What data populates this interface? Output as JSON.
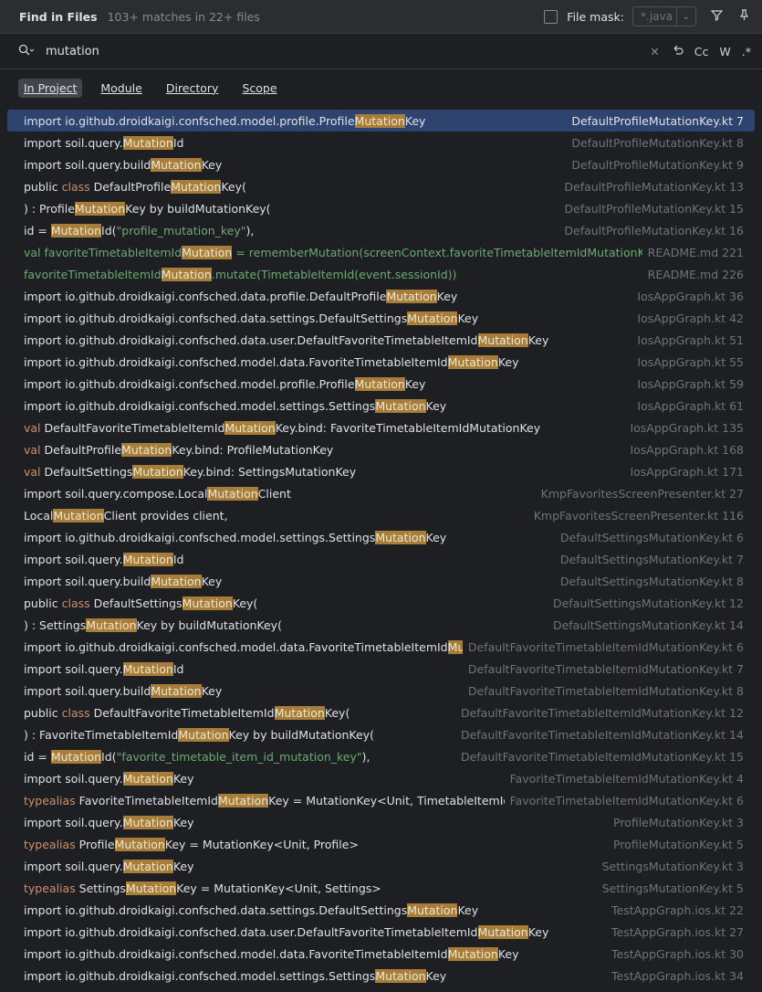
{
  "header": {
    "title": "Find in Files",
    "matches": "103+ matches in 22+ files",
    "file_mask_label": "File mask:",
    "file_mask_value": "*.java"
  },
  "search": {
    "query": "mutation",
    "toggle_case": "Cc",
    "toggle_words": "W",
    "toggle_regex": ".*"
  },
  "scopes": [
    "In Project",
    "Module",
    "Directory",
    "Scope"
  ],
  "results": [
    {
      "code": [
        [
          "t",
          "import io.github.droidkaigi.confsched.model.profile.Profile"
        ],
        [
          "h",
          "Mutation"
        ],
        [
          "t",
          "Key"
        ]
      ],
      "file": "DefaultProfileMutationKey.kt 7",
      "selected": true
    },
    {
      "code": [
        [
          "t",
          "import soil.query."
        ],
        [
          "h",
          "Mutation"
        ],
        [
          "t",
          "Id"
        ]
      ],
      "file": "DefaultProfileMutationKey.kt 8"
    },
    {
      "code": [
        [
          "t",
          "import soil.query.build"
        ],
        [
          "h",
          "Mutation"
        ],
        [
          "t",
          "Key"
        ]
      ],
      "file": "DefaultProfileMutationKey.kt 9"
    },
    {
      "code": [
        [
          "t",
          "public "
        ],
        [
          "k",
          "class"
        ],
        [
          "t",
          " DefaultProfile"
        ],
        [
          "h",
          "Mutation"
        ],
        [
          "t",
          "Key("
        ]
      ],
      "file": "DefaultProfileMutationKey.kt 13"
    },
    {
      "code": [
        [
          "t",
          ") : Profile"
        ],
        [
          "h",
          "Mutation"
        ],
        [
          "t",
          "Key by buildMutationKey("
        ]
      ],
      "file": "DefaultProfileMutationKey.kt 15"
    },
    {
      "code": [
        [
          "t",
          "id = "
        ],
        [
          "h",
          "Mutation"
        ],
        [
          "t",
          "Id("
        ],
        [
          "s",
          "\"profile_mutation_key\""
        ],
        [
          "t",
          "),"
        ]
      ],
      "file": "DefaultProfileMutationKey.kt 16"
    },
    {
      "code": [
        [
          "g",
          "  val favoriteTimetableItemId"
        ],
        [
          "h",
          "Mutation"
        ],
        [
          "g",
          " = rememberMutation(screenContext.favoriteTimetableItemIdMutationKey)"
        ]
      ],
      "file": "README.md 221"
    },
    {
      "code": [
        [
          "g",
          "            favoriteTimetableItemId"
        ],
        [
          "h",
          "Mutation"
        ],
        [
          "g",
          ".mutate(TimetableItemId(event.sessionId))"
        ]
      ],
      "file": "README.md 226"
    },
    {
      "code": [
        [
          "t",
          "import io.github.droidkaigi.confsched.data.profile.DefaultProfile"
        ],
        [
          "h",
          "Mutation"
        ],
        [
          "t",
          "Key"
        ]
      ],
      "file": "IosAppGraph.kt 36"
    },
    {
      "code": [
        [
          "t",
          "import io.github.droidkaigi.confsched.data.settings.DefaultSettings"
        ],
        [
          "h",
          "Mutation"
        ],
        [
          "t",
          "Key"
        ]
      ],
      "file": "IosAppGraph.kt 42"
    },
    {
      "code": [
        [
          "t",
          "import io.github.droidkaigi.confsched.data.user.DefaultFavoriteTimetableItemId"
        ],
        [
          "h",
          "Mutation"
        ],
        [
          "t",
          "Key"
        ]
      ],
      "file": "IosAppGraph.kt 51"
    },
    {
      "code": [
        [
          "t",
          "import io.github.droidkaigi.confsched.model.data.FavoriteTimetableItemId"
        ],
        [
          "h",
          "Mutation"
        ],
        [
          "t",
          "Key"
        ]
      ],
      "file": "IosAppGraph.kt 55"
    },
    {
      "code": [
        [
          "t",
          "import io.github.droidkaigi.confsched.model.profile.Profile"
        ],
        [
          "h",
          "Mutation"
        ],
        [
          "t",
          "Key"
        ]
      ],
      "file": "IosAppGraph.kt 59"
    },
    {
      "code": [
        [
          "t",
          "import io.github.droidkaigi.confsched.model.settings.Settings"
        ],
        [
          "h",
          "Mutation"
        ],
        [
          "t",
          "Key"
        ]
      ],
      "file": "IosAppGraph.kt 61"
    },
    {
      "code": [
        [
          "k",
          "val"
        ],
        [
          "t",
          " DefaultFavoriteTimetableItemId"
        ],
        [
          "h",
          "Mutation"
        ],
        [
          "t",
          "Key.bind: FavoriteTimetableItemIdMutationKey"
        ]
      ],
      "file": "IosAppGraph.kt 135"
    },
    {
      "code": [
        [
          "k",
          "val"
        ],
        [
          "t",
          " DefaultProfile"
        ],
        [
          "h",
          "Mutation"
        ],
        [
          "t",
          "Key.bind: ProfileMutationKey"
        ]
      ],
      "file": "IosAppGraph.kt 168"
    },
    {
      "code": [
        [
          "k",
          "val"
        ],
        [
          "t",
          " DefaultSettings"
        ],
        [
          "h",
          "Mutation"
        ],
        [
          "t",
          "Key.bind: SettingsMutationKey"
        ]
      ],
      "file": "IosAppGraph.kt 171"
    },
    {
      "code": [
        [
          "t",
          "import soil.query.compose.Local"
        ],
        [
          "h",
          "Mutation"
        ],
        [
          "t",
          "Client"
        ]
      ],
      "file": "KmpFavoritesScreenPresenter.kt 27"
    },
    {
      "code": [
        [
          "t",
          "Local"
        ],
        [
          "h",
          "Mutation"
        ],
        [
          "t",
          "Client provides client,"
        ]
      ],
      "file": "KmpFavoritesScreenPresenter.kt 116"
    },
    {
      "code": [
        [
          "t",
          "import io.github.droidkaigi.confsched.model.settings.Settings"
        ],
        [
          "h",
          "Mutation"
        ],
        [
          "t",
          "Key"
        ]
      ],
      "file": "DefaultSettingsMutationKey.kt 6"
    },
    {
      "code": [
        [
          "t",
          "import soil.query."
        ],
        [
          "h",
          "Mutation"
        ],
        [
          "t",
          "Id"
        ]
      ],
      "file": "DefaultSettingsMutationKey.kt 7"
    },
    {
      "code": [
        [
          "t",
          "import soil.query.build"
        ],
        [
          "h",
          "Mutation"
        ],
        [
          "t",
          "Key"
        ]
      ],
      "file": "DefaultSettingsMutationKey.kt 8"
    },
    {
      "code": [
        [
          "t",
          "public "
        ],
        [
          "k",
          "class"
        ],
        [
          "t",
          " DefaultSettings"
        ],
        [
          "h",
          "Mutation"
        ],
        [
          "t",
          "Key("
        ]
      ],
      "file": "DefaultSettingsMutationKey.kt 12"
    },
    {
      "code": [
        [
          "t",
          ") : Settings"
        ],
        [
          "h",
          "Mutation"
        ],
        [
          "t",
          "Key by buildMutationKey("
        ]
      ],
      "file": "DefaultSettingsMutationKey.kt 14"
    },
    {
      "code": [
        [
          "t",
          "import io.github.droidkaigi.confsched.model.data.FavoriteTimetableItemId"
        ],
        [
          "h",
          "Mutation"
        ],
        [
          "t",
          "Ke"
        ]
      ],
      "file": "DefaultFavoriteTimetableItemIdMutationKey.kt 6"
    },
    {
      "code": [
        [
          "t",
          "import soil.query."
        ],
        [
          "h",
          "Mutation"
        ],
        [
          "t",
          "Id"
        ]
      ],
      "file": "DefaultFavoriteTimetableItemIdMutationKey.kt 7"
    },
    {
      "code": [
        [
          "t",
          "import soil.query.build"
        ],
        [
          "h",
          "Mutation"
        ],
        [
          "t",
          "Key"
        ]
      ],
      "file": "DefaultFavoriteTimetableItemIdMutationKey.kt 8"
    },
    {
      "code": [
        [
          "t",
          "public "
        ],
        [
          "k",
          "class"
        ],
        [
          "t",
          " DefaultFavoriteTimetableItemId"
        ],
        [
          "h",
          "Mutation"
        ],
        [
          "t",
          "Key("
        ]
      ],
      "file": "DefaultFavoriteTimetableItemIdMutationKey.kt 12"
    },
    {
      "code": [
        [
          "t",
          ") : FavoriteTimetableItemId"
        ],
        [
          "h",
          "Mutation"
        ],
        [
          "t",
          "Key by buildMutationKey("
        ]
      ],
      "file": "DefaultFavoriteTimetableItemIdMutationKey.kt 14"
    },
    {
      "code": [
        [
          "t",
          "id = "
        ],
        [
          "h",
          "Mutation"
        ],
        [
          "t",
          "Id("
        ],
        [
          "s",
          "\"favorite_timetable_item_id_mutation_key\""
        ],
        [
          "t",
          "),"
        ]
      ],
      "file": "DefaultFavoriteTimetableItemIdMutationKey.kt 15"
    },
    {
      "code": [
        [
          "t",
          "import soil.query."
        ],
        [
          "h",
          "Mutation"
        ],
        [
          "t",
          "Key"
        ]
      ],
      "file": "FavoriteTimetableItemIdMutationKey.kt 4"
    },
    {
      "code": [
        [
          "k",
          "typealias"
        ],
        [
          "t",
          " FavoriteTimetableItemId"
        ],
        [
          "h",
          "Mutation"
        ],
        [
          "t",
          "Key = MutationKey<Unit, TimetableItemId>"
        ]
      ],
      "file": "FavoriteTimetableItemIdMutationKey.kt 6"
    },
    {
      "code": [
        [
          "t",
          "import soil.query."
        ],
        [
          "h",
          "Mutation"
        ],
        [
          "t",
          "Key"
        ]
      ],
      "file": "ProfileMutationKey.kt 3"
    },
    {
      "code": [
        [
          "k",
          "typealias"
        ],
        [
          "t",
          " Profile"
        ],
        [
          "h",
          "Mutation"
        ],
        [
          "t",
          "Key = MutationKey<Unit, Profile>"
        ]
      ],
      "file": "ProfileMutationKey.kt 5"
    },
    {
      "code": [
        [
          "t",
          "import soil.query."
        ],
        [
          "h",
          "Mutation"
        ],
        [
          "t",
          "Key"
        ]
      ],
      "file": "SettingsMutationKey.kt 3"
    },
    {
      "code": [
        [
          "k",
          "typealias"
        ],
        [
          "t",
          " Settings"
        ],
        [
          "h",
          "Mutation"
        ],
        [
          "t",
          "Key = MutationKey<Unit, Settings>"
        ]
      ],
      "file": "SettingsMutationKey.kt 5"
    },
    {
      "code": [
        [
          "t",
          "import io.github.droidkaigi.confsched.data.settings.DefaultSettings"
        ],
        [
          "h",
          "Mutation"
        ],
        [
          "t",
          "Key"
        ]
      ],
      "file": "TestAppGraph.ios.kt 22"
    },
    {
      "code": [
        [
          "t",
          "import io.github.droidkaigi.confsched.data.user.DefaultFavoriteTimetableItemId"
        ],
        [
          "h",
          "Mutation"
        ],
        [
          "t",
          "Key"
        ]
      ],
      "file": "TestAppGraph.ios.kt 27"
    },
    {
      "code": [
        [
          "t",
          "import io.github.droidkaigi.confsched.model.data.FavoriteTimetableItemId"
        ],
        [
          "h",
          "Mutation"
        ],
        [
          "t",
          "Key"
        ]
      ],
      "file": "TestAppGraph.ios.kt 30"
    },
    {
      "code": [
        [
          "t",
          "import io.github.droidkaigi.confsched.model.settings.Settings"
        ],
        [
          "h",
          "Mutation"
        ],
        [
          "t",
          "Key"
        ]
      ],
      "file": "TestAppGraph.ios.kt 34"
    }
  ]
}
